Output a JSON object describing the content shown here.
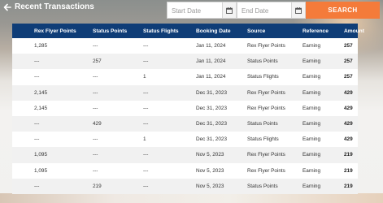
{
  "header": {
    "back_label": "Recent Transactions",
    "start_date_placeholder": "Start Date",
    "end_date_placeholder": "End Date",
    "search_label": "SEARCH"
  },
  "colors": {
    "accent": "#f47b3a",
    "table_header": "#0f3d77"
  },
  "table": {
    "columns": [
      "Rex Flyer Points",
      "Status Points",
      "Status Flights",
      "Booking Date",
      "Source",
      "Reference",
      "Amount"
    ],
    "rows": [
      [
        "1,285",
        "---",
        "---",
        "Jan 11, 2024",
        "Rex Flyer Points",
        "Earning",
        "257"
      ],
      [
        "---",
        "257",
        "---",
        "Jan 11, 2024",
        "Status Points",
        "Earning",
        "257"
      ],
      [
        "---",
        "---",
        "1",
        "Jan 11, 2024",
        "Status Flights",
        "Earning",
        "257"
      ],
      [
        "2,145",
        "---",
        "---",
        "Dec 31, 2023",
        "Rex Flyer Points",
        "Earning",
        "429"
      ],
      [
        "2,145",
        "---",
        "---",
        "Dec 31, 2023",
        "Rex Flyer Points",
        "Earning",
        "429"
      ],
      [
        "---",
        "429",
        "---",
        "Dec 31, 2023",
        "Status Points",
        "Earning",
        "429"
      ],
      [
        "---",
        "---",
        "1",
        "Dec 31, 2023",
        "Status Flights",
        "Earning",
        "429"
      ],
      [
        "1,095",
        "---",
        "---",
        "Nov 5, 2023",
        "Rex Flyer Points",
        "Earning",
        "219"
      ],
      [
        "1,095",
        "---",
        "---",
        "Nov 5, 2023",
        "Rex Flyer Points",
        "Earning",
        "219"
      ],
      [
        "---",
        "219",
        "---",
        "Nov 5, 2023",
        "Status Points",
        "Earning",
        "219"
      ]
    ]
  }
}
